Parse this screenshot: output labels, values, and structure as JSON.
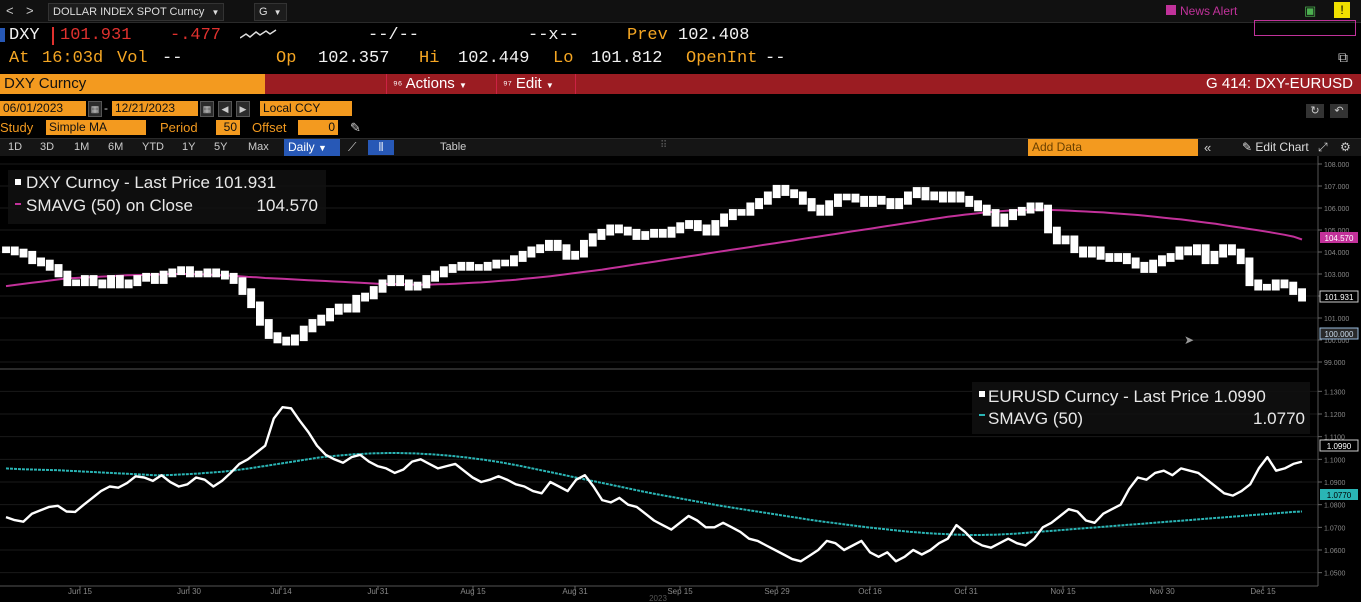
{
  "titlebar": {
    "nav_back": "<",
    "nav_fwd": ">",
    "security_name": "DOLLAR INDEX SPOT Curncy",
    "g_menu": "G",
    "news_alert": "News Alert"
  },
  "quote": {
    "ticker": "DXY",
    "last": "101.931",
    "change": "-.477",
    "bid_ask": "--/--",
    "bid_ask_x": "--x--",
    "prev_label": "Prev",
    "prev_value": "102.408",
    "at_label": "At",
    "time": "16:03d",
    "vol_label": "Vol",
    "vol_value": "--",
    "op_label": "Op",
    "op_value": "102.357",
    "hi_label": "Hi",
    "hi_value": "102.449",
    "lo_label": "Lo",
    "lo_value": "101.812",
    "openint_label": "OpenInt",
    "openint_value": "--"
  },
  "menubar": {
    "security": "DXY Curncy",
    "actions": "Actions",
    "edit": "Edit",
    "page": "G 414: DXY-EURUSD"
  },
  "controls": {
    "start_date": "06/01/2023",
    "end_date": "12/21/2023",
    "currency": "Local CCY",
    "study_label": "Study",
    "study_value": "Simple MA",
    "period_label": "Period",
    "period_value": "50",
    "offset_label": "Offset",
    "offset_value": "0"
  },
  "rangebar": {
    "ranges": [
      "1D",
      "3D",
      "1M",
      "6M",
      "YTD",
      "1Y",
      "5Y",
      "Max"
    ],
    "frequency": "Daily",
    "table": "Table",
    "add_data": "Add Data",
    "edit_chart": "Edit Chart"
  },
  "legend": {
    "dxy_last": "DXY Curncy - Last Price 101.931",
    "dxy_sma": "SMAVG (50)  on Close",
    "dxy_sma_value": "104.570",
    "eur_last": "EURUSD Curncy - Last Price 1.0990",
    "eur_sma": "SMAVG (50)",
    "eur_sma_value": "1.0770"
  },
  "colors": {
    "accent_orange": "#f39a1f",
    "menu_red": "#9b1c22",
    "dxy_sma": "#c2319a",
    "eur_sma": "#2ab5b5",
    "price": "#ffffff"
  },
  "chart_data": [
    {
      "type": "line",
      "series": [
        {
          "name": "DXY Curncy - Last Price",
          "values": [
            104.1,
            104.0,
            103.9,
            103.6,
            103.5,
            103.3,
            103.0,
            102.6,
            102.6,
            102.8,
            102.6,
            102.5,
            102.8,
            102.5,
            102.6,
            102.8,
            102.9,
            102.7,
            103.0,
            103.1,
            103.2,
            103.0,
            103.0,
            103.1,
            103.0,
            102.9,
            102.7,
            102.2,
            101.6,
            100.8,
            100.2,
            100.0,
            99.9,
            100.1,
            100.5,
            100.8,
            101.0,
            101.3,
            101.5,
            101.4,
            101.9,
            102.0,
            102.3,
            102.6,
            102.8,
            102.6,
            102.4,
            102.5,
            102.8,
            103.0,
            103.2,
            103.3,
            103.4,
            103.3,
            103.3,
            103.4,
            103.5,
            103.5,
            103.7,
            103.9,
            104.1,
            104.2,
            104.4,
            104.2,
            103.8,
            103.9,
            104.4,
            104.7,
            104.9,
            105.1,
            105.0,
            104.9,
            104.7,
            104.8,
            104.9,
            104.8,
            105.0,
            105.2,
            105.3,
            105.1,
            104.9,
            105.3,
            105.6,
            105.8,
            105.8,
            106.1,
            106.3,
            106.6,
            106.9,
            106.7,
            106.6,
            106.3,
            106.0,
            105.8,
            106.2,
            106.5,
            106.5,
            106.4,
            106.2,
            106.4,
            106.3,
            106.1,
            106.3,
            106.6,
            106.8,
            106.5,
            106.6,
            106.4,
            106.6,
            106.4,
            106.2,
            106.0,
            105.8,
            105.3,
            105.6,
            105.8,
            105.9,
            106.1,
            106.0,
            105.0,
            104.5,
            104.6,
            104.1,
            103.9,
            104.1,
            103.8,
            103.7,
            103.8,
            103.6,
            103.4,
            103.2,
            103.5,
            103.7,
            103.8,
            104.1,
            104.0,
            104.2,
            103.6,
            103.9,
            104.2,
            104.0,
            103.6,
            102.6,
            102.4,
            102.4,
            102.6,
            102.5,
            102.2,
            101.9
          ],
          "color": "#ffffff"
        },
        {
          "name": "SMAVG (50) on Close",
          "values": [
            102.45,
            102.5,
            102.55,
            102.6,
            102.65,
            102.7,
            102.75,
            102.8,
            102.82,
            102.84,
            102.86,
            102.88,
            102.9,
            102.92,
            102.94,
            102.95,
            102.96,
            102.97,
            102.98,
            103.0,
            103.0,
            103.0,
            102.99,
            102.98,
            102.96,
            102.94,
            102.92,
            102.9,
            102.87,
            102.85,
            102.82,
            102.8,
            102.78,
            102.76,
            102.74,
            102.72,
            102.7,
            102.68,
            102.66,
            102.64,
            102.62,
            102.6,
            102.58,
            102.56,
            102.55,
            102.54,
            102.53,
            102.52,
            102.52,
            102.52,
            102.53,
            102.54,
            102.56,
            102.58,
            102.6,
            102.62,
            102.65,
            102.68,
            102.71,
            102.74,
            102.78,
            102.82,
            102.86,
            102.9,
            102.95,
            103.0,
            103.05,
            103.1,
            103.15,
            103.2,
            103.26,
            103.32,
            103.38,
            103.44,
            103.5,
            103.56,
            103.62,
            103.68,
            103.74,
            103.8,
            103.86,
            103.92,
            103.98,
            104.04,
            104.1,
            104.16,
            104.22,
            104.28,
            104.34,
            104.4,
            104.46,
            104.52,
            104.58,
            104.64,
            104.7,
            104.76,
            104.82,
            104.88,
            104.94,
            105.0,
            105.06,
            105.12,
            105.18,
            105.24,
            105.3,
            105.36,
            105.42,
            105.48,
            105.54,
            105.6,
            105.65,
            105.7,
            105.74,
            105.78,
            105.82,
            105.85,
            105.88,
            105.9,
            105.91,
            105.92,
            105.92,
            105.91,
            105.9,
            105.88,
            105.86,
            105.84,
            105.82,
            105.8,
            105.77,
            105.74,
            105.71,
            105.68,
            105.64,
            105.6,
            105.56,
            105.52,
            105.48,
            105.43,
            105.38,
            105.33,
            105.28,
            105.22,
            105.16,
            105.1,
            105.04,
            104.98,
            104.92,
            104.85,
            104.78,
            104.7,
            104.57
          ],
          "color": "#c2319a"
        }
      ],
      "y_axis_ticks": [
        "108.000",
        "107.000",
        "106.000",
        "105.000",
        "104.000",
        "103.000",
        "102.000",
        "101.000",
        "100.000",
        "99.000"
      ],
      "ylim": [
        99.0,
        108.0
      ],
      "last_price_label": "101.931",
      "sma_label": "104.570",
      "right_marker": "100.000"
    },
    {
      "type": "line",
      "series": [
        {
          "name": "EURUSD Curncy - Last Price",
          "values": [
            1.0745,
            1.0732,
            1.0725,
            1.076,
            1.0775,
            1.079,
            1.0795,
            1.077,
            1.0768,
            1.08,
            1.083,
            1.086,
            1.088,
            1.0875,
            1.0895,
            1.0925,
            1.092,
            1.0905,
            1.093,
            1.09,
            1.088,
            1.089,
            1.092,
            1.091,
            1.088,
            1.0905,
            1.094,
            1.098,
            1.1,
            1.103,
            1.106,
            1.118,
            1.123,
            1.1225,
            1.117,
            1.112,
            1.106,
            1.102,
            1.1,
            1.0985,
            1.101,
            1.102,
            1.099,
            1.097,
            1.096,
            1.094,
            1.0955,
            1.099,
            1.1,
            1.098,
            1.096,
            1.097,
            1.098,
            1.095,
            1.092,
            1.09,
            1.091,
            1.0925,
            1.091,
            1.089,
            1.088,
            1.086,
            1.085,
            1.09,
            1.088,
            1.086,
            1.091,
            1.093,
            1.088,
            1.082,
            1.081,
            1.083,
            1.08,
            1.079,
            1.076,
            1.073,
            1.071,
            1.069,
            1.072,
            1.075,
            1.073,
            1.07,
            1.07,
            1.072,
            1.07,
            1.068,
            1.065,
            1.064,
            1.062,
            1.06,
            1.058,
            1.056,
            1.055,
            1.0575,
            1.06,
            1.064,
            1.063,
            1.06,
            1.062,
            1.064,
            1.059,
            1.057,
            1.059,
            1.055,
            1.057,
            1.06,
            1.058,
            1.06,
            1.063,
            1.065,
            1.071,
            1.068,
            1.064,
            1.062,
            1.061,
            1.063,
            1.065,
            1.063,
            1.062,
            1.065,
            1.07,
            1.072,
            1.075,
            1.078,
            1.077,
            1.073,
            1.072,
            1.076,
            1.078,
            1.08,
            1.087,
            1.092,
            1.091,
            1.094,
            1.095,
            1.093,
            1.096,
            1.095,
            1.094,
            1.091,
            1.088,
            1.085,
            1.084,
            1.086,
            1.089,
            1.096,
            1.101,
            1.095,
            1.096,
            1.098,
            1.099
          ],
          "color": "#ffffff"
        },
        {
          "name": "SMAVG (50)",
          "values": [
            1.096,
            1.0958,
            1.0956,
            1.0955,
            1.0954,
            1.0953,
            1.0952,
            1.095,
            1.0948,
            1.0946,
            1.0944,
            1.0942,
            1.094,
            1.0938,
            1.0936,
            1.0934,
            1.0932,
            1.093,
            1.093,
            1.0931,
            1.0933,
            1.0935,
            1.0937,
            1.094,
            1.0943,
            1.0946,
            1.095,
            1.0955,
            1.096,
            1.0966,
            1.0972,
            1.0978,
            1.0984,
            1.099,
            1.0996,
            1.1002,
            1.1008,
            1.1012,
            1.1016,
            1.1019,
            1.1022,
            1.1024,
            1.1026,
            1.1027,
            1.1028,
            1.1028,
            1.1027,
            1.1026,
            1.1024,
            1.1022,
            1.1019,
            1.1016,
            1.1012,
            1.1008,
            1.1003,
            1.0998,
            1.0992,
            1.0986,
            1.0979,
            1.0972,
            1.0964,
            1.0956,
            1.0948,
            1.094,
            1.0932,
            1.0924,
            1.0916,
            1.0908,
            1.09,
            1.0892,
            1.0884,
            1.0876,
            1.0868,
            1.086,
            1.0852,
            1.0845,
            1.0838,
            1.0831,
            1.0824,
            1.0817,
            1.081,
            1.0803,
            1.0796,
            1.079,
            1.0784,
            1.0778,
            1.0772,
            1.0766,
            1.076,
            1.0754,
            1.0748,
            1.0742,
            1.0736,
            1.073,
            1.0725,
            1.072,
            1.0715,
            1.071,
            1.0705,
            1.07,
            1.0696,
            1.0692,
            1.0688,
            1.0684,
            1.068,
            1.0677,
            1.0674,
            1.0672,
            1.067,
            1.0668,
            1.0667,
            1.0666,
            1.0666,
            1.0667,
            1.0668,
            1.067,
            1.0672,
            1.0675,
            1.0678,
            1.0681,
            1.0684,
            1.0687,
            1.069,
            1.0693,
            1.0696,
            1.0699,
            1.0702,
            1.0705,
            1.0708,
            1.0711,
            1.0714,
            1.0717,
            1.072,
            1.0723,
            1.0726,
            1.0729,
            1.0732,
            1.0735,
            1.0738,
            1.0741,
            1.0744,
            1.0747,
            1.075,
            1.0753,
            1.0756,
            1.0759,
            1.0762,
            1.0765,
            1.0768,
            1.077
          ],
          "color": "#2ab5b5"
        }
      ],
      "y_axis_ticks": [
        "1.1300",
        "1.1200",
        "1.1100",
        "1.1000",
        "1.0900",
        "1.0800",
        "1.0700",
        "1.0600",
        "1.0500"
      ],
      "ylim": [
        1.045,
        1.135
      ],
      "last_price_label": "1.0990",
      "sma_label": "1.0770"
    }
  ],
  "x_axis": {
    "ticks": [
      "Jun 15",
      "Jun 30",
      "Jul 14",
      "Jul 31",
      "Aug 15",
      "Aug 31",
      "Sep 15",
      "Sep 29",
      "Oct 16",
      "Oct 31",
      "Nov 15",
      "Nov 30",
      "Dec 15"
    ],
    "year": "2023"
  }
}
